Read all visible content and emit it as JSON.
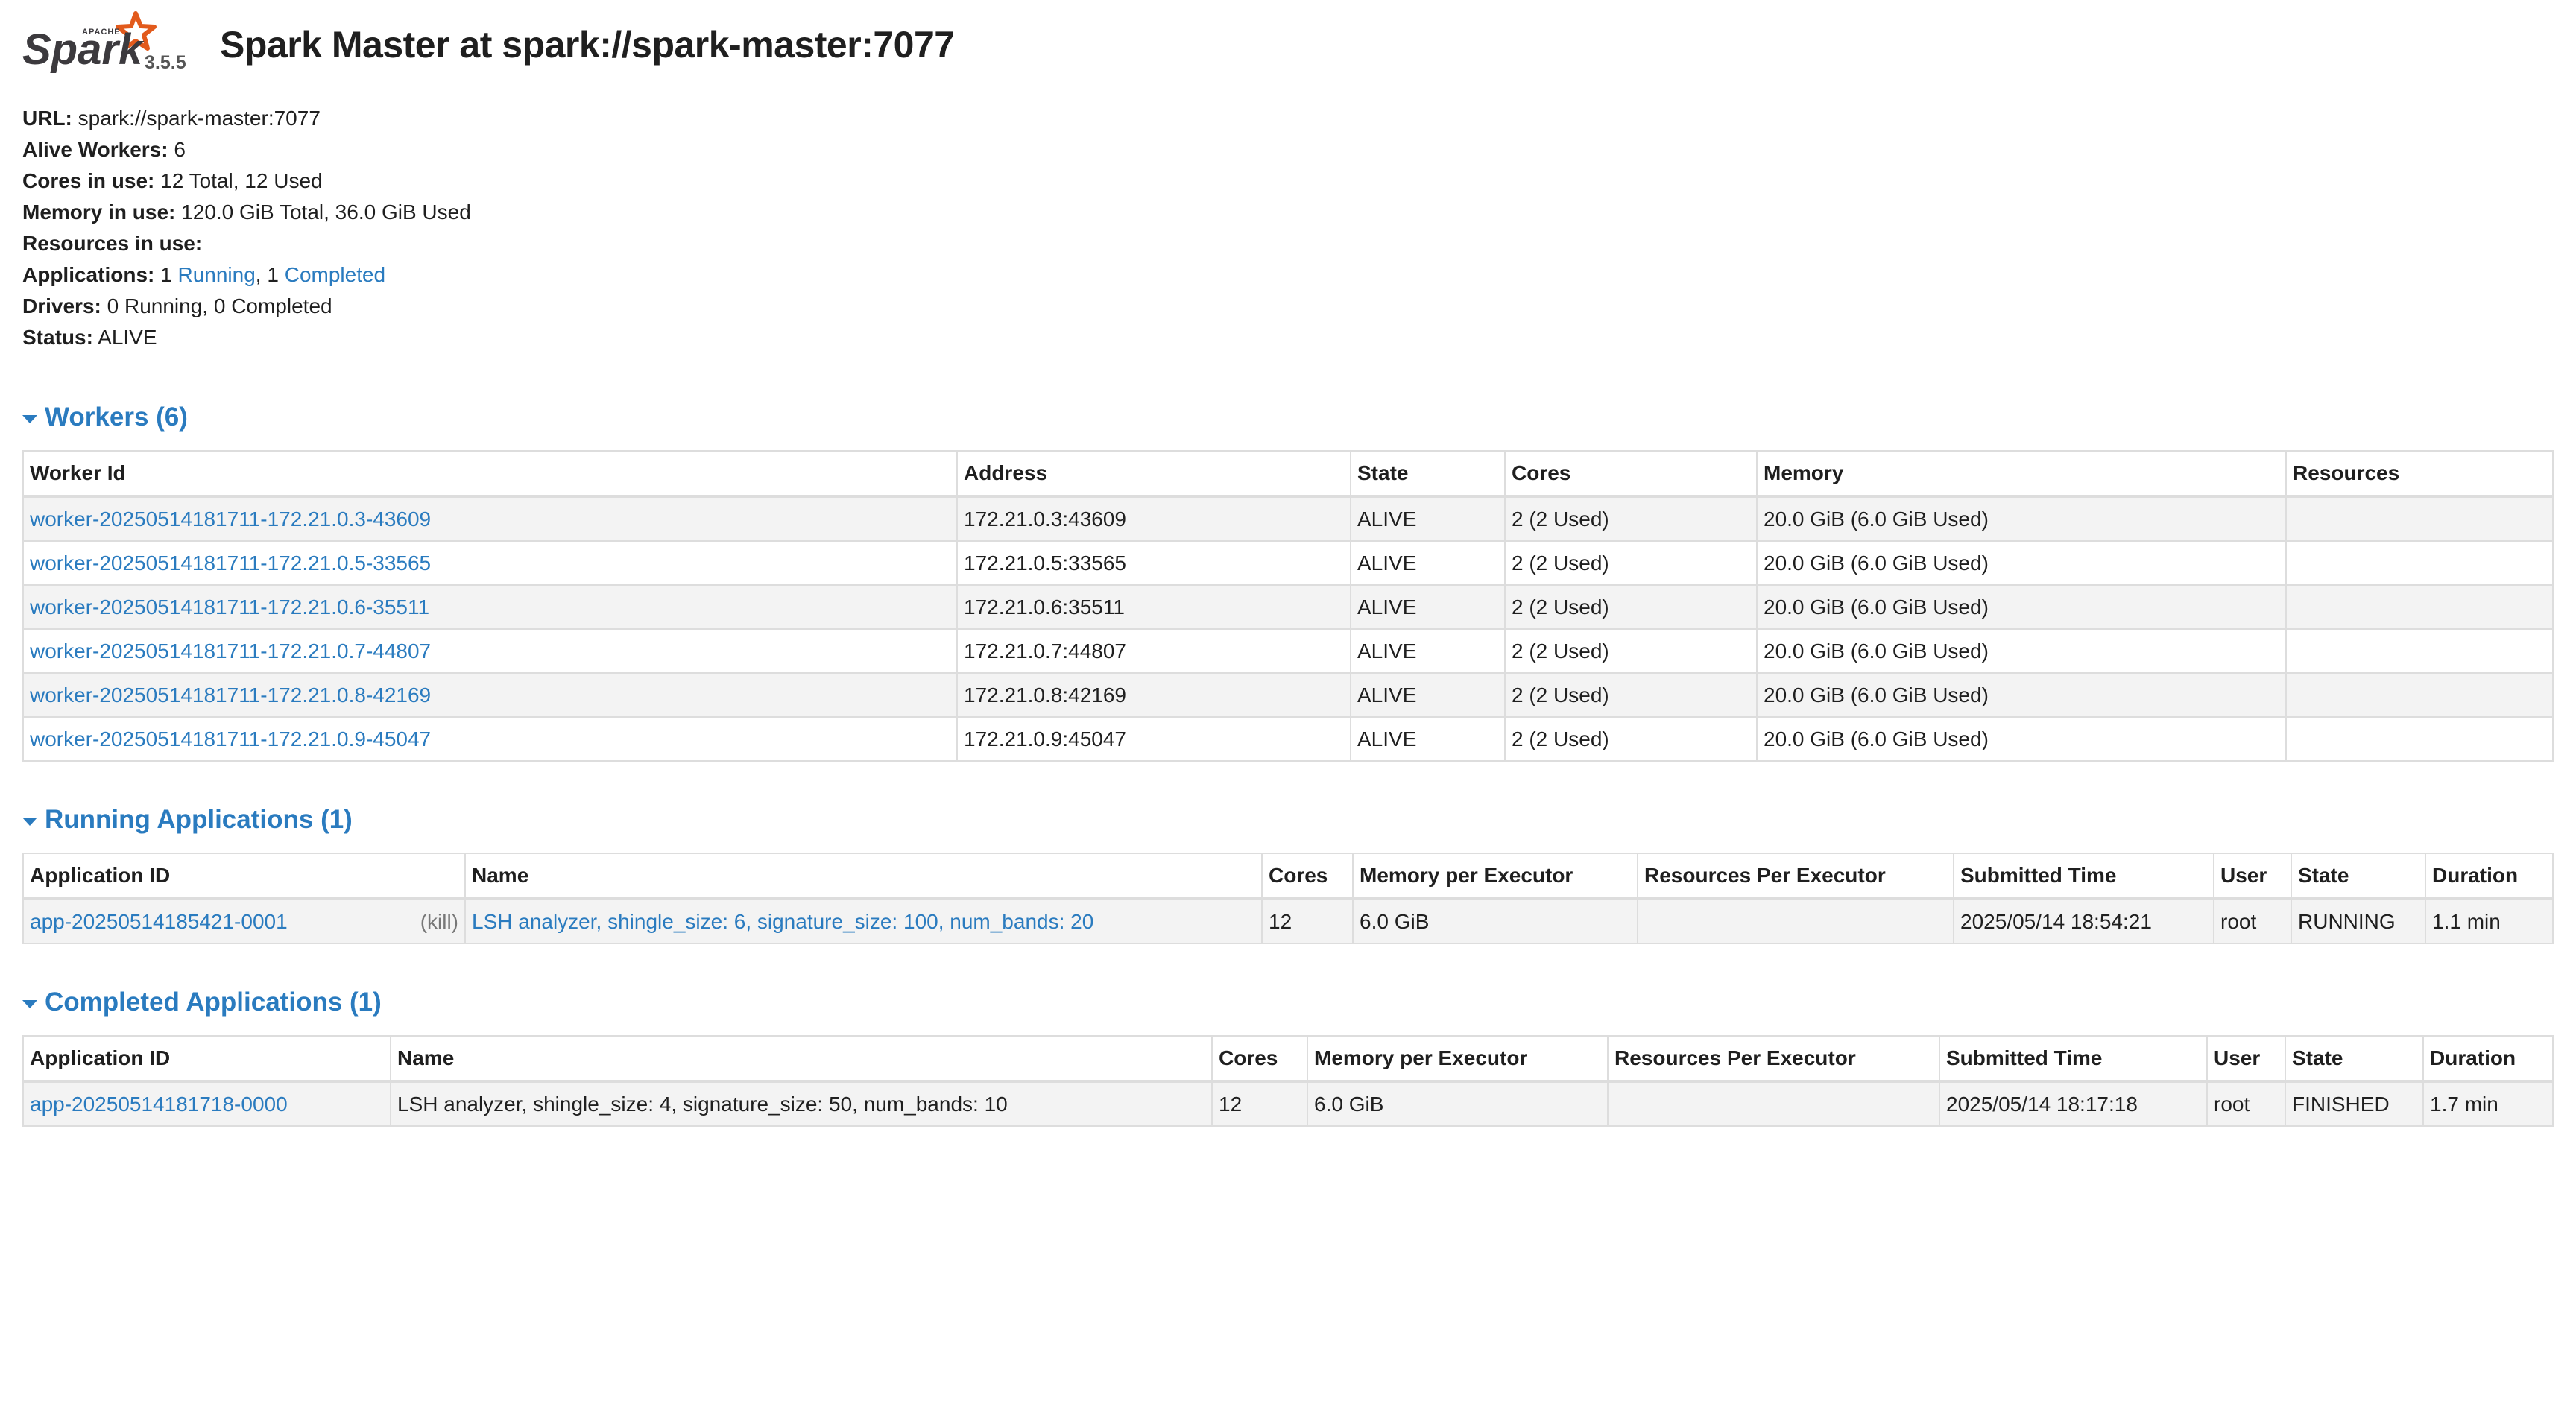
{
  "header": {
    "logo_top_text": "APACHE",
    "logo_text": "Spark",
    "version": "3.5.5",
    "title": "Spark Master at spark://spark-master:7077"
  },
  "summary": {
    "url_label": "URL:",
    "url_value": "spark://spark-master:7077",
    "alive_workers_label": "Alive Workers:",
    "alive_workers_value": "6",
    "cores_label": "Cores in use:",
    "cores_value": "12 Total, 12 Used",
    "memory_label": "Memory in use:",
    "memory_value": "120.0 GiB Total, 36.0 GiB Used",
    "resources_label": "Resources in use:",
    "applications_label": "Applications:",
    "applications_running_count": "1",
    "applications_running_link": "Running",
    "applications_completed_count": "1",
    "applications_completed_link": "Completed",
    "drivers_label": "Drivers:",
    "drivers_value": "0 Running, 0 Completed",
    "status_label": "Status:",
    "status_value": "ALIVE"
  },
  "workers": {
    "title": "Workers (6)",
    "columns": [
      "Worker Id",
      "Address",
      "State",
      "Cores",
      "Memory",
      "Resources"
    ],
    "rows": [
      {
        "id": "worker-20250514181711-172.21.0.3-43609",
        "address": "172.21.0.3:43609",
        "state": "ALIVE",
        "cores": "2 (2 Used)",
        "memory": "20.0 GiB (6.0 GiB Used)",
        "resources": ""
      },
      {
        "id": "worker-20250514181711-172.21.0.5-33565",
        "address": "172.21.0.5:33565",
        "state": "ALIVE",
        "cores": "2 (2 Used)",
        "memory": "20.0 GiB (6.0 GiB Used)",
        "resources": ""
      },
      {
        "id": "worker-20250514181711-172.21.0.6-35511",
        "address": "172.21.0.6:35511",
        "state": "ALIVE",
        "cores": "2 (2 Used)",
        "memory": "20.0 GiB (6.0 GiB Used)",
        "resources": ""
      },
      {
        "id": "worker-20250514181711-172.21.0.7-44807",
        "address": "172.21.0.7:44807",
        "state": "ALIVE",
        "cores": "2 (2 Used)",
        "memory": "20.0 GiB (6.0 GiB Used)",
        "resources": ""
      },
      {
        "id": "worker-20250514181711-172.21.0.8-42169",
        "address": "172.21.0.8:42169",
        "state": "ALIVE",
        "cores": "2 (2 Used)",
        "memory": "20.0 GiB (6.0 GiB Used)",
        "resources": ""
      },
      {
        "id": "worker-20250514181711-172.21.0.9-45047",
        "address": "172.21.0.9:45047",
        "state": "ALIVE",
        "cores": "2 (2 Used)",
        "memory": "20.0 GiB (6.0 GiB Used)",
        "resources": ""
      }
    ]
  },
  "running_apps": {
    "title": "Running Applications (1)",
    "columns": [
      "Application ID",
      "Name",
      "Cores",
      "Memory per Executor",
      "Resources Per Executor",
      "Submitted Time",
      "User",
      "State",
      "Duration"
    ],
    "rows": [
      {
        "app_id": "app-20250514185421-0001",
        "kill_label": "(kill)",
        "name": "LSH analyzer, shingle_size: 6, signature_size: 100, num_bands: 20",
        "cores": "12",
        "memory": "6.0 GiB",
        "resources": "",
        "submitted": "2025/05/14 18:54:21",
        "user": "root",
        "state": "RUNNING",
        "duration": "1.1 min"
      }
    ]
  },
  "completed_apps": {
    "title": "Completed Applications (1)",
    "columns": [
      "Application ID",
      "Name",
      "Cores",
      "Memory per Executor",
      "Resources Per Executor",
      "Submitted Time",
      "User",
      "State",
      "Duration"
    ],
    "rows": [
      {
        "app_id": "app-20250514181718-0000",
        "name": "LSH analyzer, shingle_size: 4, signature_size: 50, num_bands: 10",
        "cores": "12",
        "memory": "6.0 GiB",
        "resources": "",
        "submitted": "2025/05/14 18:17:18",
        "user": "root",
        "state": "FINISHED",
        "duration": "1.7 min"
      }
    ]
  },
  "colors": {
    "link": "#2a7bbf",
    "logo_orange": "#e25a1c",
    "logo_text": "#3c3a3e"
  }
}
